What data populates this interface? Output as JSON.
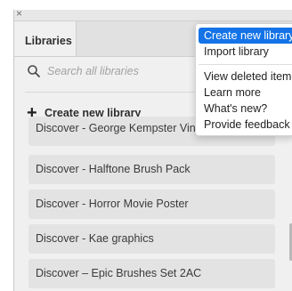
{
  "window": {
    "close_icon": "close-icon"
  },
  "tabs": [
    {
      "label": "Libraries"
    }
  ],
  "search": {
    "placeholder": "Search all libraries",
    "icon": "search-icon"
  },
  "create_library": {
    "label": "Create new library",
    "icon": "plus-icon"
  },
  "libraries": [
    {
      "label": "Discover - George Kempster Vintage Stickers"
    },
    {
      "label": "Discover - Halftone Brush Pack"
    },
    {
      "label": "Discover - Horror Movie Poster"
    },
    {
      "label": "Discover - Kae graphics"
    },
    {
      "label": "Discover – Epic Brushes Set 2AC"
    }
  ],
  "menu": {
    "items": [
      {
        "label": "Create new library",
        "highlighted": true
      },
      {
        "label": "Import library",
        "highlighted": false
      },
      {
        "label": "View deleted items",
        "highlighted": false
      },
      {
        "label": "Learn more",
        "highlighted": false
      },
      {
        "label": "What's new?",
        "highlighted": false
      },
      {
        "label": "Provide feedback",
        "highlighted": false
      }
    ]
  },
  "colors": {
    "accent": "#1473e6",
    "panel_background": "#f0f0f0",
    "item_background": "#e3e3e3"
  }
}
